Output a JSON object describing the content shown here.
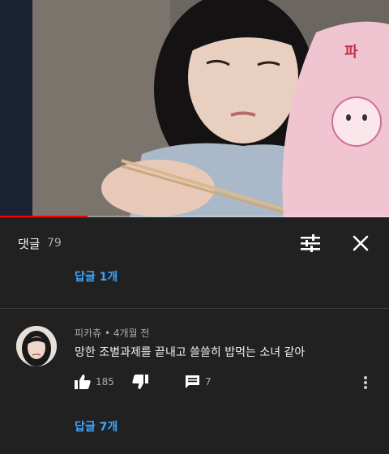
{
  "video": {
    "progress_fraction": 0.225
  },
  "comments_panel": {
    "title": "댓글",
    "count": "79",
    "sort_icon": "tune-icon",
    "close_icon": "close-icon"
  },
  "previous_thread": {
    "reply_link": "답글 1개"
  },
  "comment": {
    "author": "피카츄",
    "separator": "•",
    "age": "4개월 전",
    "text": "망한 조별과제를 끝내고 쓸쓸히 밥먹는 소녀 같아",
    "likes": "185",
    "replies": "7",
    "reply_link": "답글 7개"
  },
  "colors": {
    "background": "#212121",
    "link": "#3ea6ff",
    "progress": "#ff0000"
  }
}
